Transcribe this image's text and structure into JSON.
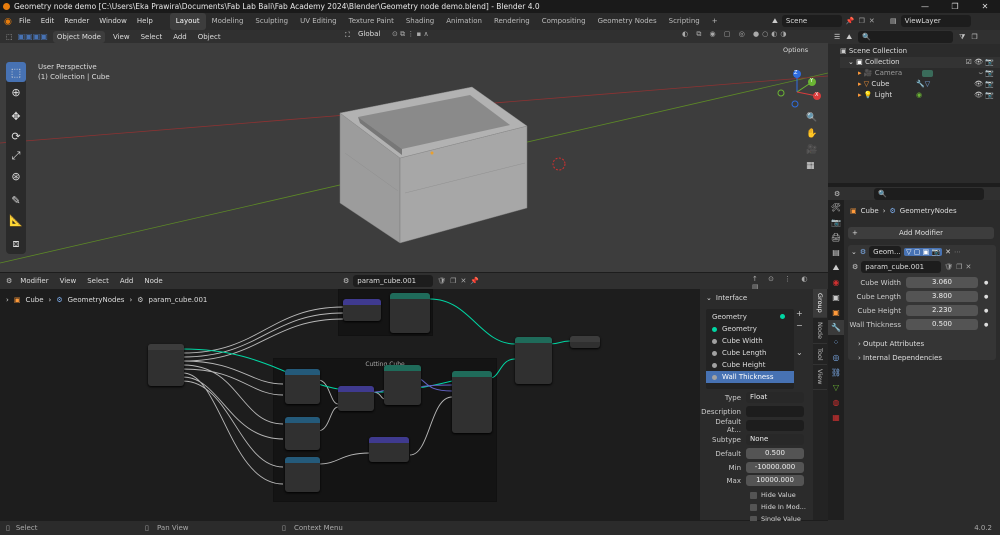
{
  "window": {
    "title": "Geometry node demo [C:\\Users\\Eka Prawira\\Documents\\Fab Lab Bali\\Fab Academy 2024\\Blender\\Geometry node demo.blend] - Blender 4.0",
    "minimize": "—",
    "maximize": "❐",
    "close": "✕"
  },
  "menu": [
    "File",
    "Edit",
    "Render",
    "Window",
    "Help"
  ],
  "workspaces": [
    "Layout",
    "Modeling",
    "Sculpting",
    "UV Editing",
    "Texture Paint",
    "Shading",
    "Animation",
    "Rendering",
    "Compositing",
    "Geometry Nodes",
    "Scripting"
  ],
  "workspace_add": "+",
  "scene": {
    "label": "Scene",
    "view_layer": "ViewLayer"
  },
  "viewport": {
    "mode": "Object Mode",
    "menus": [
      "View",
      "Select",
      "Add",
      "Object"
    ],
    "orientation": "Global",
    "options": "Options",
    "overlay_title": "User Perspective",
    "overlay_sub": "(1) Collection | Cube",
    "gizmo_x": "X",
    "gizmo_y": "Y",
    "gizmo_z": "Z"
  },
  "node_editor": {
    "editor": "Modifier",
    "menus": [
      "View",
      "Select",
      "Add",
      "Node"
    ],
    "tree_name": "param_cube.001",
    "breadcrumb": [
      "Cube",
      "GeometryNodes",
      "param_cube.001"
    ],
    "frame_label": "Cutting Cube",
    "side_tabs": [
      "Group",
      "Node",
      "Tool",
      "View"
    ]
  },
  "interface_panel": {
    "title": "Interface",
    "items": [
      {
        "label": "Geometry",
        "kind": "output",
        "color": "#00d6a3"
      },
      {
        "label": "Geometry",
        "kind": "input",
        "color": "#00d6a3"
      },
      {
        "label": "Cube Width",
        "kind": "input",
        "color": "#a1a1a1"
      },
      {
        "label": "Cube Length",
        "kind": "input",
        "color": "#a1a1a1"
      },
      {
        "label": "Cube Height",
        "kind": "input",
        "color": "#a1a1a1"
      },
      {
        "label": "Wall Thickness",
        "kind": "input",
        "color": "#a1a1a1",
        "selected": true
      }
    ],
    "type_label": "Type",
    "type_value": "Float",
    "description_label": "Description",
    "default_attr_label": "Default At...",
    "subtype_label": "Subtype",
    "subtype_value": "None",
    "default_label": "Default",
    "default_value": "0.500",
    "min_label": "Min",
    "min_value": "-10000.000",
    "max_label": "Max",
    "max_value": "10000.000",
    "hide_value": "Hide Value",
    "hide_in_modifier": "Hide In Mod...",
    "single_value": "Single Value"
  },
  "outliner": {
    "root": "Scene Collection",
    "collection": "Collection",
    "objects": [
      "Camera",
      "Cube",
      "Light"
    ]
  },
  "properties": {
    "breadcrumb_obj": "Cube",
    "breadcrumb_mod": "GeometryNodes",
    "add_modifier": "Add Modifier",
    "modifier_name": "Geom...",
    "node_group": "param_cube.001",
    "params": [
      {
        "label": "Cube Width",
        "value": "3.060"
      },
      {
        "label": "Cube Length",
        "value": "3.800"
      },
      {
        "label": "Cube Height",
        "value": "2.230"
      },
      {
        "label": "Wall Thickness",
        "value": "0.500"
      }
    ],
    "sections": [
      "Output Attributes",
      "Internal Dependencies"
    ]
  },
  "status": {
    "select": "Select",
    "pan": "Pan View",
    "context": "Context Menu",
    "version": "4.0.2"
  },
  "colors": {
    "accent": "#4772b3",
    "geometry_socket": "#00d6a3",
    "float_socket": "#a1a1a1",
    "vector_socket": "#6363c7",
    "axis_red": "#8f3232",
    "axis_green": "#5d8a26"
  }
}
